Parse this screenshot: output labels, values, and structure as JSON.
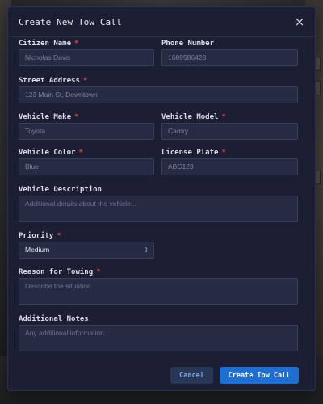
{
  "modal": {
    "title": "Create New Tow Call",
    "close_icon": "×"
  },
  "fields": {
    "citizen_name": {
      "label": "Citizen Name",
      "required": "*",
      "value": "Nicholas Davis"
    },
    "phone_number": {
      "label": "Phone Number",
      "value": "1689586428"
    },
    "street_address": {
      "label": "Street Address",
      "required": "*",
      "placeholder": "123 Main St, Downtown"
    },
    "vehicle_make": {
      "label": "Vehicle Make",
      "required": "*",
      "placeholder": "Toyota"
    },
    "vehicle_model": {
      "label": "Vehicle Model",
      "required": "*",
      "placeholder": "Camry"
    },
    "vehicle_color": {
      "label": "Vehicle Color",
      "required": "*",
      "placeholder": "Blue"
    },
    "license_plate": {
      "label": "License Plate",
      "required": "*",
      "placeholder": "ABC123"
    },
    "vehicle_description": {
      "label": "Vehicle Description",
      "placeholder": "Additional details about the vehicle..."
    },
    "priority": {
      "label": "Priority",
      "required": "*",
      "value": "Medium",
      "icon": "chevron-updown-icon"
    },
    "reason": {
      "label": "Reason for Towing",
      "required": "*",
      "placeholder": "Describe the situation..."
    },
    "notes": {
      "label": "Additional Notes",
      "placeholder": "Any additional information..."
    }
  },
  "buttons": {
    "cancel": "Cancel",
    "create": "Create Tow Call"
  },
  "colors": {
    "modal_bg": "#1c1f33",
    "input_bg": "#262a42",
    "required": "#e0434a",
    "primary": "#1e6fd1"
  }
}
